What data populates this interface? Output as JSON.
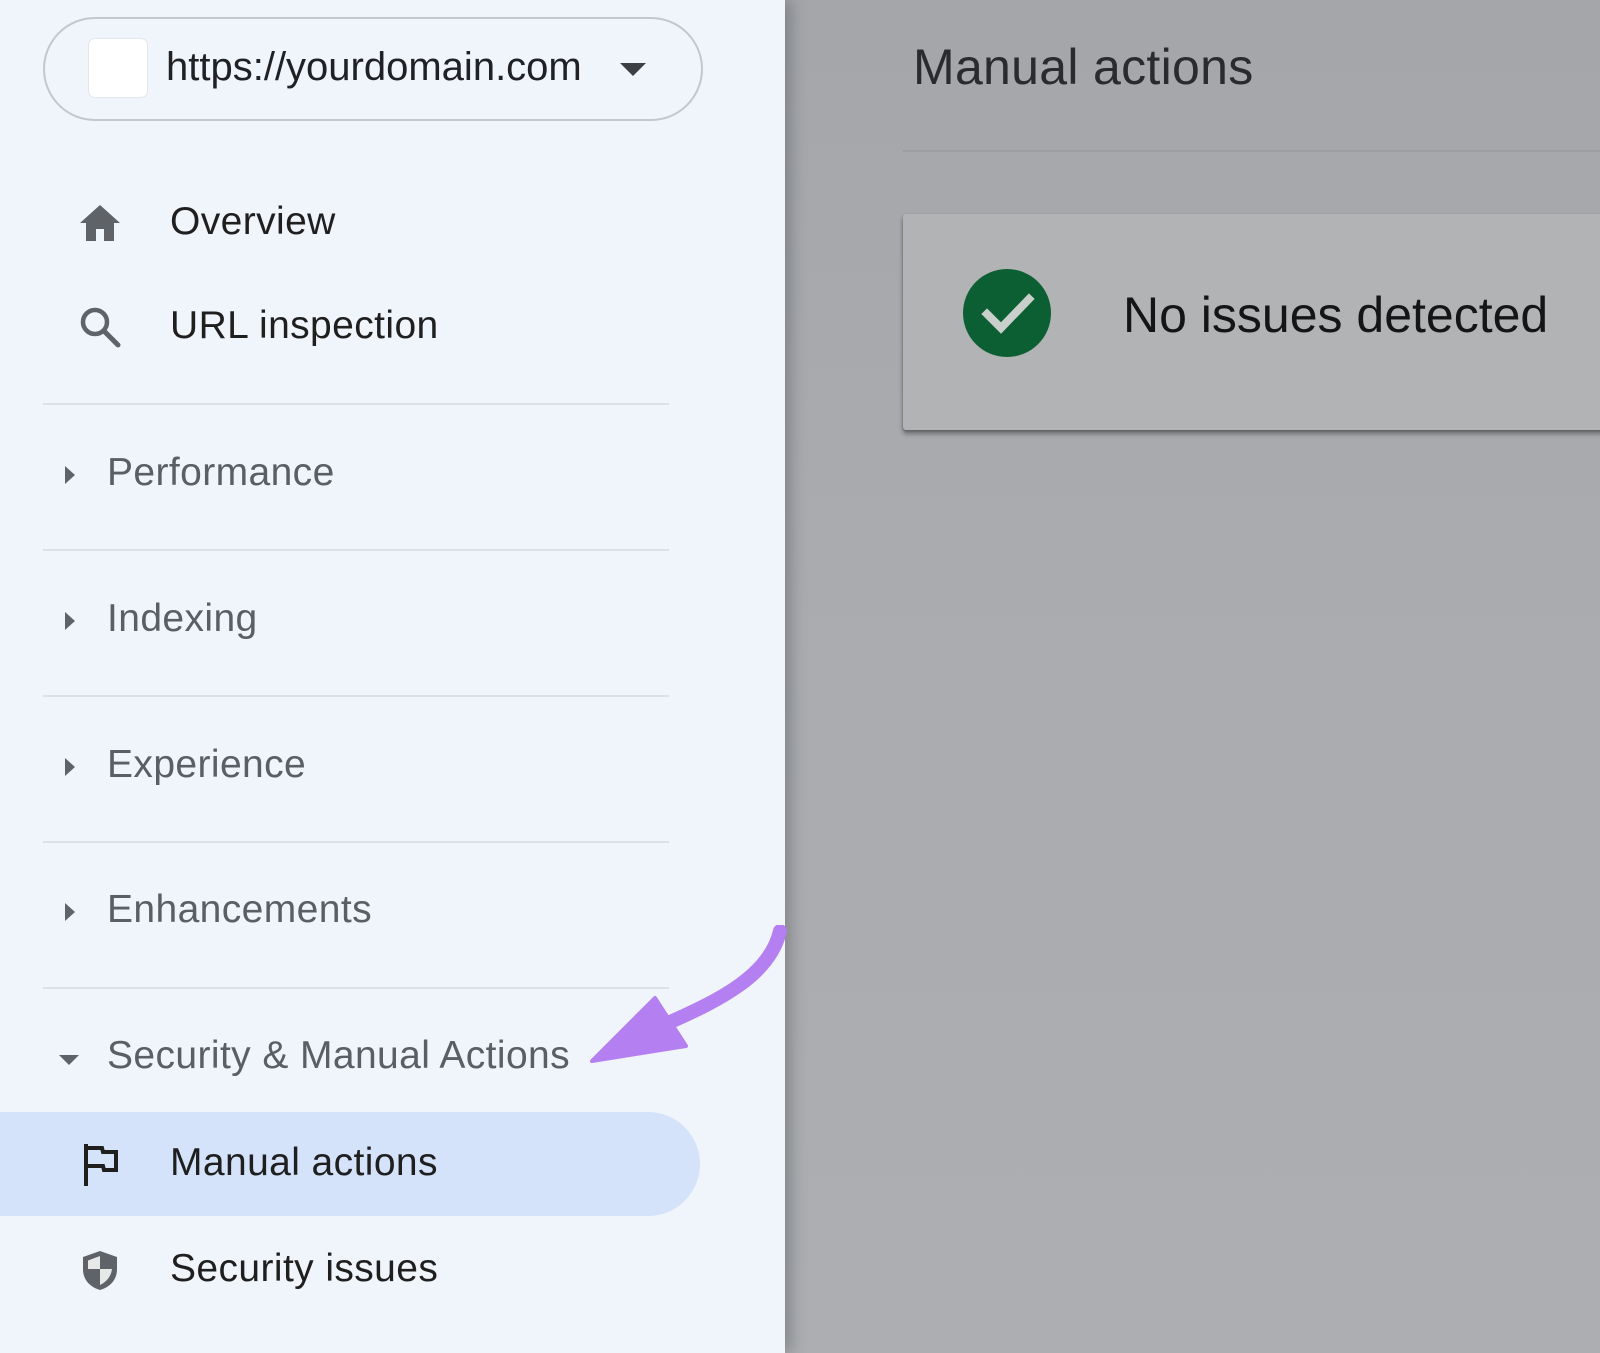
{
  "property": {
    "url": "https://yourdomain.com"
  },
  "nav": {
    "overview": "Overview",
    "url_inspection": "URL inspection"
  },
  "sections": {
    "performance": "Performance",
    "indexing": "Indexing",
    "experience": "Experience",
    "enhancements": "Enhancements",
    "security_manual_actions": "Security & Manual Actions"
  },
  "sub_nav": {
    "manual_actions": "Manual actions",
    "security_issues": "Security issues"
  },
  "main": {
    "page_title": "Manual actions",
    "status_text": "No issues detected"
  },
  "colors": {
    "sidebar_bg": "#f0f4fb",
    "active_item_bg": "#d4e2fa",
    "status_check_green": "#0c5f32",
    "annotation_arrow": "#b47ff0"
  },
  "icons": {
    "overview": "home-icon",
    "url_inspection": "search-icon",
    "manual_actions": "flag-icon",
    "security_issues": "shield-icon"
  }
}
